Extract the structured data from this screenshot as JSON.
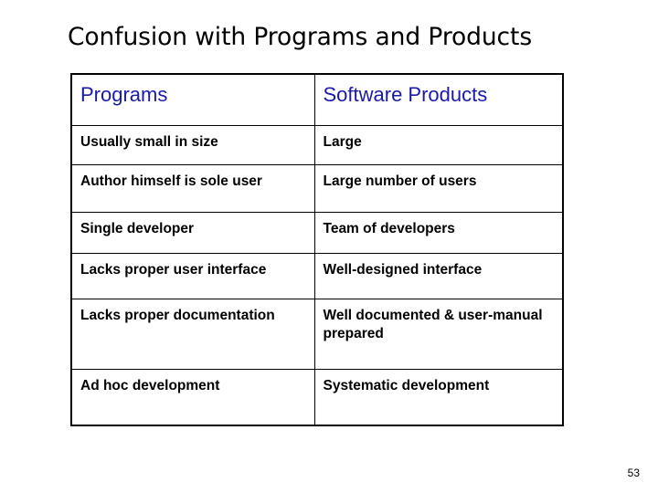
{
  "slide": {
    "title": "Confusion with Programs and Products",
    "page_number": "53",
    "accent_color": "#1A1AA8",
    "text_color": "#000000",
    "background_color": "#FFFFFF"
  },
  "table": {
    "headers": [
      "Programs",
      "Software Products"
    ],
    "rows": [
      [
        "Usually small in size",
        "Large"
      ],
      [
        "Author himself is sole user",
        "Large number of users"
      ],
      [
        "Single developer",
        "Team of developers"
      ],
      [
        "Lacks proper user interface",
        "Well-designed interface"
      ],
      [
        "Lacks proper documentation",
        "Well documented & user-manual prepared"
      ],
      [
        "Ad hoc development",
        "Systematic development"
      ]
    ]
  }
}
